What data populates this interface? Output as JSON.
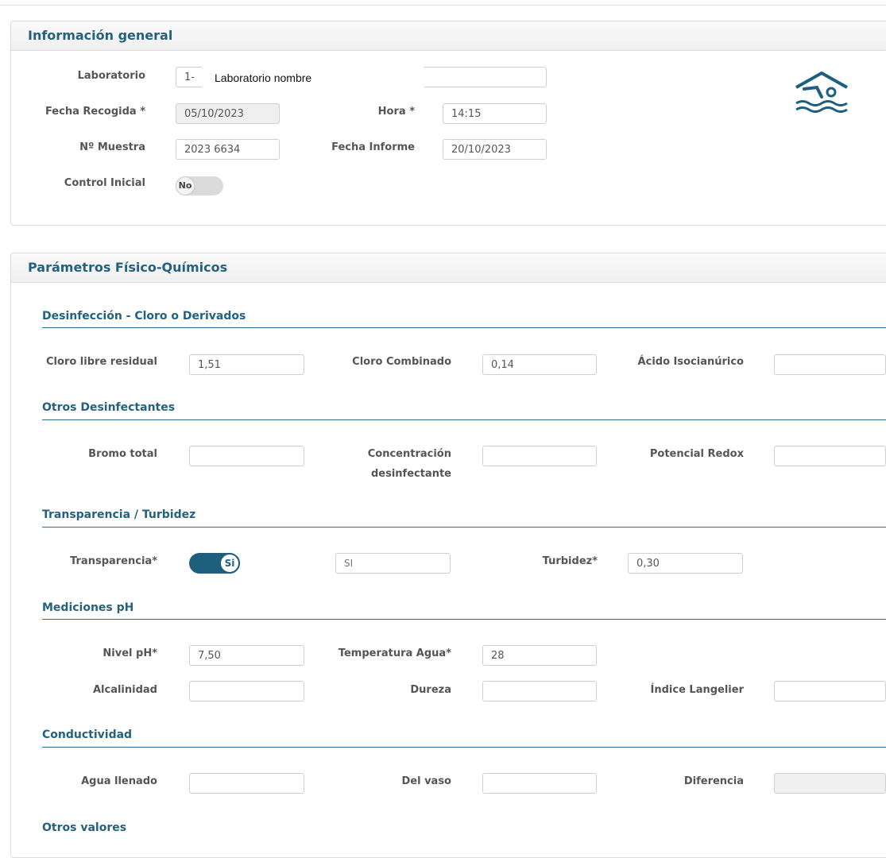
{
  "general": {
    "title": "Información general",
    "laboratorio_label": "Laboratorio",
    "laboratorio_code": "1-",
    "laboratorio_name": "Laboratorio nombre",
    "fecha_recogida_label": "Fecha Recogida *",
    "fecha_recogida_value": "05/10/2023",
    "hora_label": "Hora *",
    "hora_value": "14:15",
    "muestra_label": "Nº Muestra",
    "muestra_value": "2023 6634",
    "fecha_informe_label": "Fecha Informe",
    "fecha_informe_value": "20/10/2023",
    "control_label": "Control Inicial",
    "control_value": "No",
    "icon": "swimming-pool-icon"
  },
  "fisico": {
    "title": "Parámetros Físico-Químicos",
    "desinfeccion": {
      "title": "Desinfección - Cloro o Derivados",
      "cloro_libre_label": "Cloro libre residual",
      "cloro_libre_value": "1,51",
      "cloro_combinado_label": "Cloro Combinado",
      "cloro_combinado_value": "0,14",
      "acido_label": "Ácido Isocianúrico",
      "acido_value": ""
    },
    "otros_desinfectantes": {
      "title": "Otros Desinfectantes",
      "bromo_label": "Bromo total",
      "concentracion_label_1": "Concentración",
      "concentracion_label_2": "desinfectante",
      "redox_label": "Potencial Redox"
    },
    "transparencia": {
      "title": "Transparencia / Turbidez",
      "transparencia_label": "Transparencia*",
      "toggle_value": "Si",
      "transparencia_value": "SI",
      "turbidez_label": "Turbidez*",
      "turbidez_value": "0,30"
    },
    "ph": {
      "title": "Mediciones pH",
      "nivel_label": "Nivel pH*",
      "nivel_value": "7,50",
      "temperatura_label": "Temperatura Agua*",
      "temperatura_value": "28",
      "alcalinidad_label": "Alcalinidad",
      "dureza_label": "Dureza",
      "langelier_label": "Índice Langelier"
    },
    "conductividad": {
      "title": "Conductividad",
      "agua_label": "Agua llenado",
      "vaso_label": "Del vaso",
      "diferencia_label": "Diferencia"
    },
    "otros_valores_title": "Otros valores"
  },
  "colors": {
    "accent": "#23617e",
    "toggle_on": "#1e5f7e"
  }
}
